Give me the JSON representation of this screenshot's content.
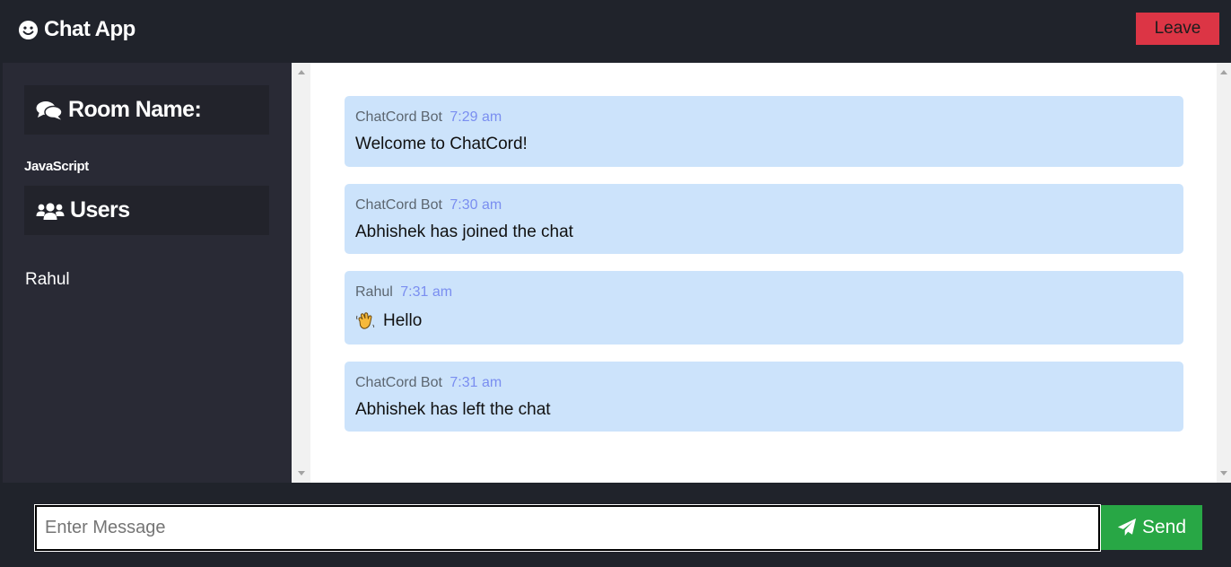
{
  "header": {
    "brand_icon": "smile-icon",
    "brand_title": "Chat App",
    "leave_label": "Leave"
  },
  "sidebar": {
    "room_heading_icon": "comments-icon",
    "room_heading": "Room Name:",
    "room_name": "JavaScript",
    "users_heading_icon": "users-icon",
    "users_heading": "Users",
    "users": [
      "Rahul"
    ]
  },
  "messages": [
    {
      "user": "ChatCord Bot",
      "time": "7:29 am",
      "text": "Welcome to ChatCord!"
    },
    {
      "user": "ChatCord Bot",
      "time": "7:30 am",
      "text": "Abhishek has joined the chat"
    },
    {
      "user": "Rahul",
      "time": "7:31 am",
      "text": "Hello",
      "emoji": "waving-hand-icon"
    },
    {
      "user": "ChatCord Bot",
      "time": "7:31 am",
      "text": "Abhishek has left the chat"
    }
  ],
  "composer": {
    "placeholder": "Enter Message",
    "value": "",
    "send_icon": "paper-plane-icon",
    "send_label": "Send"
  },
  "colors": {
    "background": "#20232b",
    "sidebar": "#292a35",
    "message_bubble": "#cce3fb",
    "leave_button": "#dc3545",
    "send_button": "#28a745",
    "timestamp": "#7a8ef0"
  }
}
